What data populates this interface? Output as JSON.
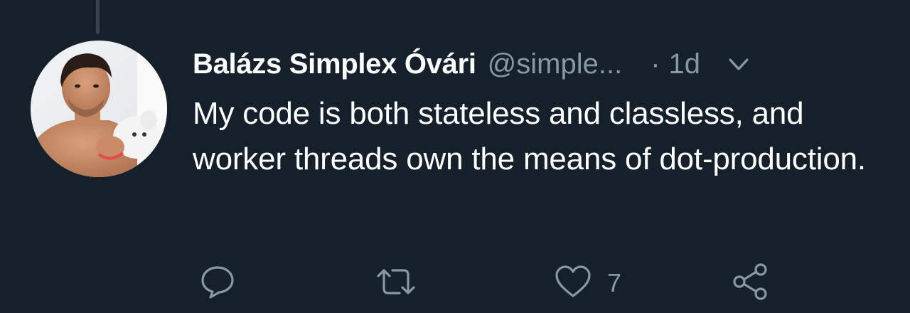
{
  "tweet": {
    "author_name": "Balázs Simplex Óvári",
    "author_handle": "@simple...",
    "separator": "·",
    "timestamp": "1d",
    "text": "My code is both stateless and classless, and worker threads own the means of dot-production.",
    "actions": {
      "reply_icon": "speech-bubble-icon",
      "retweet_icon": "retweet-arrows-icon",
      "like_icon": "heart-outline-icon",
      "like_count": "7",
      "share_icon": "share-nodes-icon",
      "menu_icon": "chevron-down-icon"
    }
  },
  "colors": {
    "background": "#15202b",
    "primary_text": "#ffffff",
    "secondary_text": "#8899a6",
    "thread_line": "#38444d"
  }
}
